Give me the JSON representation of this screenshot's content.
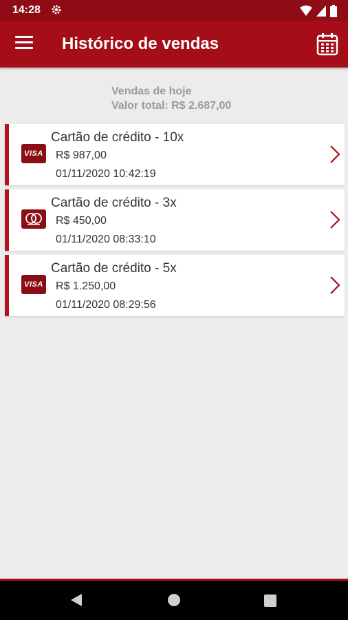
{
  "status_bar": {
    "time": "14:28"
  },
  "app_bar": {
    "title": "Histórico de vendas"
  },
  "summary": {
    "line1": "Vendas de hoje",
    "line2": "Valor total: R$ 2.687,00"
  },
  "sales": [
    {
      "brand": "VISA",
      "title": "Cartão de crédito - 10x",
      "amount": "R$ 987,00",
      "datetime": "01/11/2020 10:42:19"
    },
    {
      "brand": "MASTERCARD",
      "title": "Cartão de crédito - 3x",
      "amount": "R$ 450,00",
      "datetime": "01/11/2020 08:33:10"
    },
    {
      "brand": "VISA",
      "title": "Cartão de crédito - 5x",
      "amount": "R$ 1.250,00",
      "datetime": "01/11/2020 08:29:56"
    }
  ],
  "colors": {
    "primary": "#a50e19",
    "status_bar": "#8f0c16",
    "background": "#ececec",
    "summary_text": "#9a9a9a"
  }
}
